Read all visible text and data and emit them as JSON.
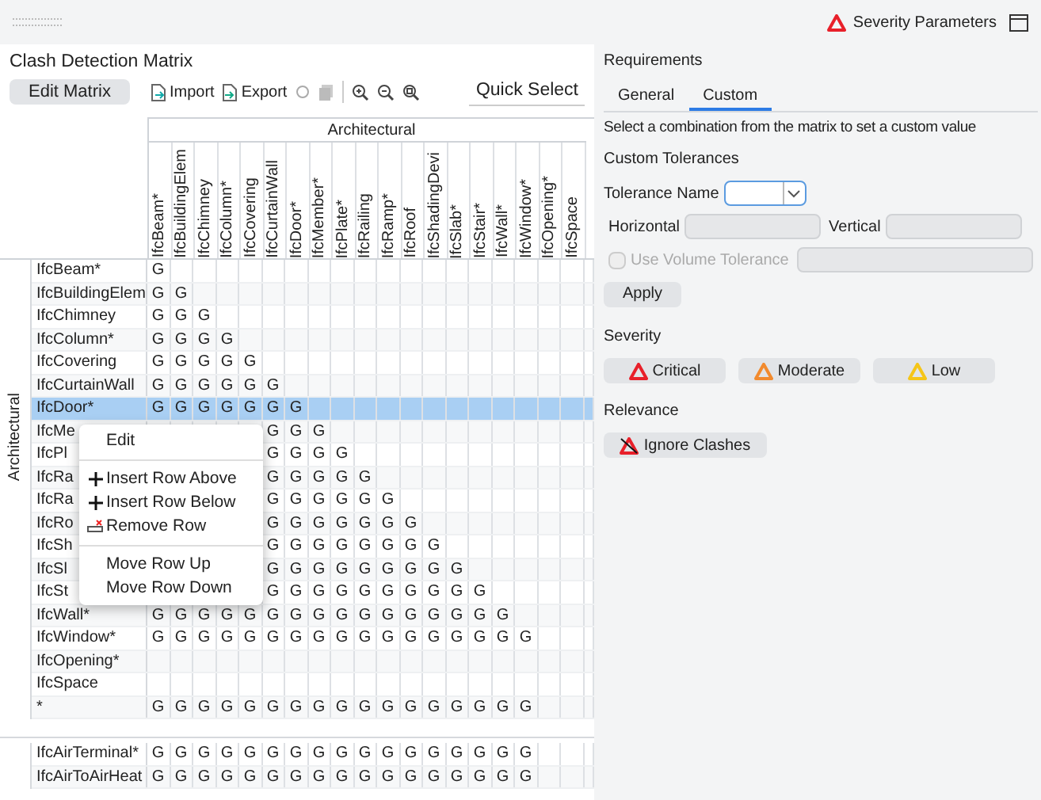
{
  "top_bar": {
    "severity_link": "Severity Parameters"
  },
  "matrix_panel": {
    "title": "Clash Detection Matrix",
    "toolbar": {
      "edit_button": "Edit Matrix",
      "import_button": "Import",
      "export_button": "Export",
      "quick_select": "Quick Select"
    },
    "column_group": "Architectural",
    "columns": [
      "IfcBeam*",
      "IfcBuildingElem",
      "IfcChimney",
      "IfcColumn*",
      "IfcCovering",
      "IfcCurtainWall",
      "IfcDoor*",
      "IfcMember*",
      "IfcPlate*",
      "IfcRailing",
      "IfcRamp*",
      "IfcRoof",
      "IfcShadingDevi",
      "IfcSlab*",
      "IfcStair*",
      "IfcWall*",
      "IfcWindow*",
      "IfcOpening*",
      "IfcSpace"
    ],
    "row_groups": [
      {
        "label": "Architectural",
        "rows": [
          {
            "label": "IfcBeam*",
            "selected": false,
            "cells": [
              "G"
            ]
          },
          {
            "label": "IfcBuildingElem",
            "selected": false,
            "cells": [
              "G",
              "G"
            ]
          },
          {
            "label": "IfcChimney",
            "selected": false,
            "cells": [
              "G",
              "G",
              "G"
            ]
          },
          {
            "label": "IfcColumn*",
            "selected": false,
            "cells": [
              "G",
              "G",
              "G",
              "G"
            ]
          },
          {
            "label": "IfcCovering",
            "selected": false,
            "cells": [
              "G",
              "G",
              "G",
              "G",
              "G"
            ]
          },
          {
            "label": "IfcCurtainWall",
            "selected": false,
            "cells": [
              "G",
              "G",
              "G",
              "G",
              "G",
              "G"
            ]
          },
          {
            "label": "IfcDoor*",
            "selected": true,
            "cells": [
              "G",
              "G",
              "G",
              "G",
              "G",
              "G",
              "G"
            ]
          },
          {
            "label": "IfcMe",
            "selected": false,
            "cells": [
              "",
              "",
              "",
              "",
              "",
              "G",
              "G",
              "G"
            ]
          },
          {
            "label": "IfcPl",
            "selected": false,
            "cells": [
              "",
              "",
              "",
              "",
              "",
              "G",
              "G",
              "G",
              "G"
            ]
          },
          {
            "label": "IfcRa",
            "selected": false,
            "cells": [
              "",
              "",
              "",
              "",
              "",
              "G",
              "G",
              "G",
              "G",
              "G"
            ]
          },
          {
            "label": "IfcRa",
            "selected": false,
            "cells": [
              "",
              "",
              "",
              "",
              "",
              "G",
              "G",
              "G",
              "G",
              "G",
              "G"
            ]
          },
          {
            "label": "IfcRo",
            "selected": false,
            "cells": [
              "",
              "",
              "",
              "",
              "",
              "G",
              "G",
              "G",
              "G",
              "G",
              "G",
              "G"
            ]
          },
          {
            "label": "IfcSh",
            "selected": false,
            "cells": [
              "",
              "",
              "",
              "",
              "",
              "G",
              "G",
              "G",
              "G",
              "G",
              "G",
              "G",
              "G"
            ]
          },
          {
            "label": "IfcSl",
            "selected": false,
            "cells": [
              "",
              "",
              "",
              "",
              "",
              "G",
              "G",
              "G",
              "G",
              "G",
              "G",
              "G",
              "G",
              "G"
            ]
          },
          {
            "label": "IfcSt",
            "selected": false,
            "cells": [
              "",
              "",
              "",
              "",
              "",
              "G",
              "G",
              "G",
              "G",
              "G",
              "G",
              "G",
              "G",
              "G",
              "G"
            ]
          },
          {
            "label": "IfcWall*",
            "selected": false,
            "cells": [
              "G",
              "G",
              "G",
              "G",
              "G",
              "G",
              "G",
              "G",
              "G",
              "G",
              "G",
              "G",
              "G",
              "G",
              "G",
              "G"
            ]
          },
          {
            "label": "IfcWindow*",
            "selected": false,
            "cells": [
              "G",
              "G",
              "G",
              "G",
              "G",
              "G",
              "G",
              "G",
              "G",
              "G",
              "G",
              "G",
              "G",
              "G",
              "G",
              "G",
              "G"
            ]
          },
          {
            "label": "IfcOpening*",
            "selected": false,
            "cells": []
          },
          {
            "label": "IfcSpace",
            "selected": false,
            "cells": []
          },
          {
            "label": "*",
            "selected": false,
            "cells": [
              "G",
              "G",
              "G",
              "G",
              "G",
              "G",
              "G",
              "G",
              "G",
              "G",
              "G",
              "G",
              "G",
              "G",
              "G",
              "G",
              "G"
            ]
          }
        ]
      },
      {
        "rows": [
          {
            "label": "IfcAirTerminal*",
            "selected": false,
            "cells": [
              "G",
              "G",
              "G",
              "G",
              "G",
              "G",
              "G",
              "G",
              "G",
              "G",
              "G",
              "G",
              "G",
              "G",
              "G",
              "G",
              "G"
            ]
          },
          {
            "label": "IfcAirToAirHeat",
            "selected": false,
            "cells": [
              "G",
              "G",
              "G",
              "G",
              "G",
              "G",
              "G",
              "G",
              "G",
              "G",
              "G",
              "G",
              "G",
              "G",
              "G",
              "G",
              "G"
            ]
          }
        ]
      }
    ],
    "context_menu": [
      {
        "label": "Edit",
        "kind": "plain"
      },
      {
        "kind": "separator"
      },
      {
        "label": "Insert Row Above",
        "kind": "insert"
      },
      {
        "label": "Insert Row Below",
        "kind": "insert"
      },
      {
        "label": "Remove Row",
        "kind": "remove"
      },
      {
        "kind": "separator"
      },
      {
        "label": "Move Row Up",
        "kind": "plain"
      },
      {
        "label": "Move Row Down",
        "kind": "plain"
      }
    ]
  },
  "requirements": {
    "title": "Requirements",
    "tabs": [
      {
        "label": "General",
        "selected": false
      },
      {
        "label": "Custom",
        "selected": true
      }
    ],
    "hint": "Select a combination from the matrix to set a custom value",
    "custom_tolerances": "Custom Tolerances",
    "tolerance_name": "Tolerance Name",
    "horizontal": "Horizontal",
    "vertical": "Vertical",
    "volume_tolerance": {
      "label": "Use Volume Tolerance",
      "checked": false,
      "disabled": true
    },
    "apply": "Apply",
    "severity_title": "Severity",
    "severity_buttons": [
      {
        "label": "Critical",
        "color": "#e8202a"
      },
      {
        "label": "Moderate",
        "color": "#f28a2e"
      },
      {
        "label": "Low",
        "color": "#f5c518"
      }
    ],
    "relevance_title": "Relevance",
    "ignore_button": "Ignore Clashes"
  }
}
